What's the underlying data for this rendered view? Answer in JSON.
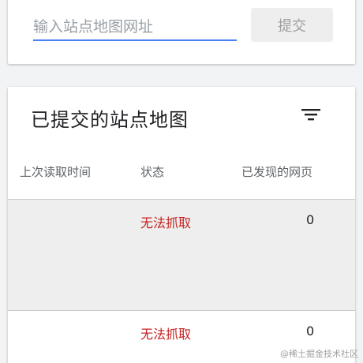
{
  "submit": {
    "input_placeholder": "输入站点地图网址",
    "input_value": "",
    "button_label": "提交"
  },
  "sitemaps": {
    "title": "已提交的站点地图",
    "filter_icon": "filter-list-icon",
    "columns": {
      "last_read": "上次读取时间",
      "status": "状态",
      "pages_found": "已发现的网页"
    },
    "rows": [
      {
        "last_read": "",
        "status": "无法抓取",
        "pages_found": "0"
      },
      {
        "last_read": "",
        "status": "无法抓取",
        "pages_found": "0"
      }
    ]
  },
  "colors": {
    "accent": "#4a80f5",
    "error": "#c5221f",
    "selected_row": "#eeeeee"
  },
  "watermark": "@稀土掘金技术社区"
}
